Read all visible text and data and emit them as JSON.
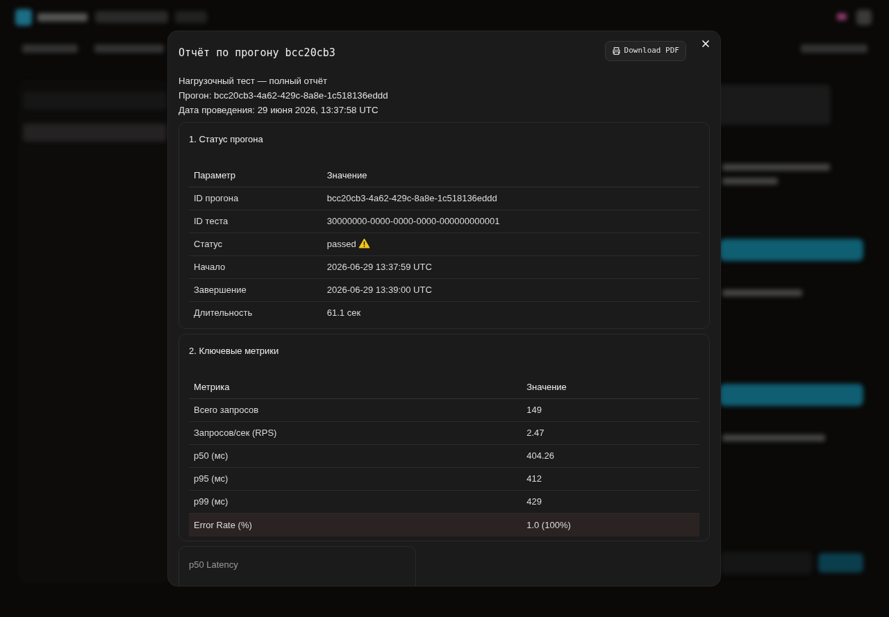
{
  "modal": {
    "title": "Отчёт по прогону bcc20cb3",
    "download_button": "Download PDF",
    "summary": [
      "Нагрузочный тест — полный отчёт",
      "Прогон: bcc20cb3-4a62-429c-8a8e-1c518136eddd",
      "Дата проведения: 29 июня 2026, 13:37:58 UTC"
    ],
    "sections": [
      {
        "title": "1. Статус прогона",
        "columns": [
          "Параметр",
          "Значение"
        ],
        "rows": [
          {
            "cells": [
              "ID прогона",
              "bcc20cb3-4a62-429c-8a8e-1c518136eddd"
            ],
            "warning": false,
            "highlighted": false
          },
          {
            "cells": [
              "ID теста",
              "30000000-0000-0000-0000-000000000001"
            ],
            "warning": false,
            "highlighted": false
          },
          {
            "cells": [
              "Статус",
              "passed"
            ],
            "warning": true,
            "highlighted": false
          },
          {
            "cells": [
              "Начало",
              "2026-06-29 13:37:59 UTC"
            ],
            "warning": false,
            "highlighted": false
          },
          {
            "cells": [
              "Завершение",
              "2026-06-29 13:39:00 UTC"
            ],
            "warning": false,
            "highlighted": false
          },
          {
            "cells": [
              "Длительность",
              "61.1 сек"
            ],
            "warning": false,
            "highlighted": false
          }
        ]
      },
      {
        "title": "2. Ключевые метрики",
        "columns": [
          "Метрика",
          "Значение"
        ],
        "rows": [
          {
            "cells": [
              "Всего запросов",
              "149"
            ],
            "warning": false,
            "highlighted": false
          },
          {
            "cells": [
              "Запросов/сек (RPS)",
              "2.47"
            ],
            "warning": false,
            "highlighted": false
          },
          {
            "cells": [
              "p50 (мс)",
              "404.26"
            ],
            "warning": false,
            "highlighted": false
          },
          {
            "cells": [
              "p95 (мс)",
              "412"
            ],
            "warning": false,
            "highlighted": false
          },
          {
            "cells": [
              "p99 (мс)",
              "429"
            ],
            "warning": false,
            "highlighted": false
          },
          {
            "cells": [
              "Error Rate (%)",
              "1.0 (100%)"
            ],
            "warning": false,
            "highlighted": true
          }
        ]
      }
    ],
    "chart_cards": [
      {
        "title": "p50 Latency"
      }
    ]
  }
}
